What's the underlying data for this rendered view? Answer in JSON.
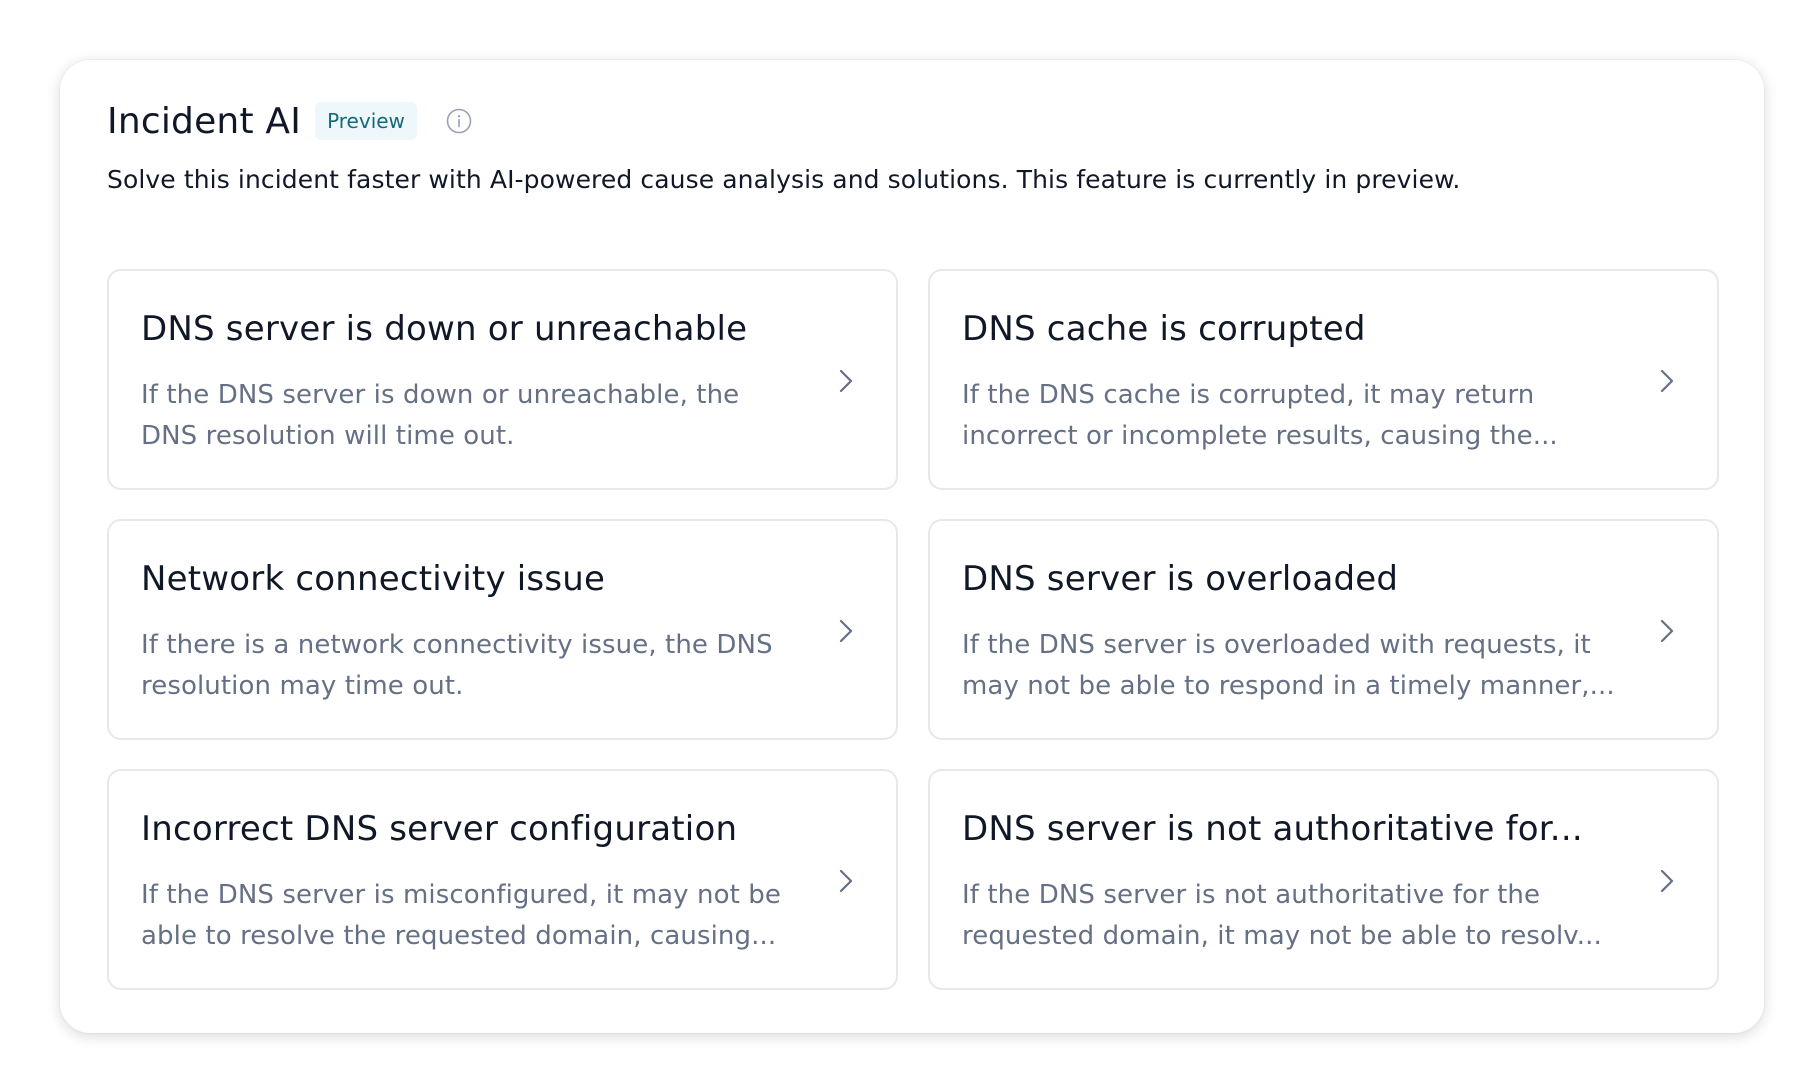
{
  "panel": {
    "title": "Incident AI",
    "badge": "Preview",
    "info_icon": "info-circle-icon",
    "description": "Solve this incident faster with AI-powered cause analysis and solutions. This feature is currently in preview."
  },
  "colors": {
    "title": "#101828",
    "badge_bg": "#eef7f9",
    "badge_text": "#166979",
    "muted_text": "#667085",
    "card_border": "#e6e8ec"
  },
  "causes": [
    {
      "title": "DNS server is down or unreachable",
      "description": "If the DNS server is down or unreachable, the DNS resolution will time out."
    },
    {
      "title": "DNS cache is corrupted",
      "description": "If the DNS cache is corrupted, it may return incorrect or incomplete results, causing the..."
    },
    {
      "title": "Network connectivity issue",
      "description": "If there is a network connectivity issue, the DNS resolution may time out."
    },
    {
      "title": "DNS server is overloaded",
      "description": "If the DNS server is overloaded with requests, it may not be able to respond in a timely manner,..."
    },
    {
      "title": "Incorrect DNS server configuration",
      "description": "If the DNS server is misconfigured, it may not be able to resolve the requested domain, causing..."
    },
    {
      "title": "DNS server is not authoritative for...",
      "description": "If the DNS server is not authoritative for the requested domain, it may not be able to resolv..."
    }
  ]
}
